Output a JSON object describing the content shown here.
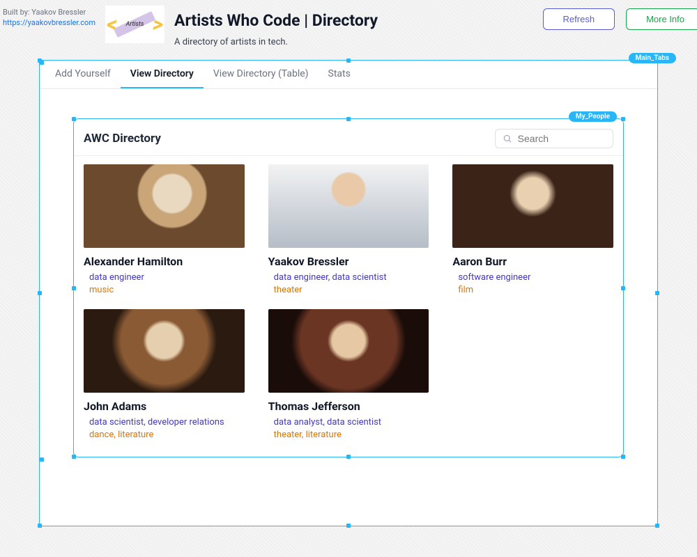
{
  "builtby_label": "Built by: Yaakov Bressler",
  "builtby_link_text": "https://yaakovbressler.com",
  "logo_text": "Artists",
  "page_title": "Artists Who Code | Directory",
  "page_subtitle": "A directory of artists in tech.",
  "buttons": {
    "refresh": "Refresh",
    "more_info": "More Info"
  },
  "badges": {
    "main_tabs": "Main_Tabs",
    "my_people": "My_People"
  },
  "tabs": [
    "Add Yourself",
    "View Directory",
    "View Directory (Table)",
    "Stats"
  ],
  "active_tab_index": 1,
  "panel_title": "AWC Directory",
  "search_placeholder": "Search",
  "people": [
    {
      "name": "Alexander Hamilton",
      "roles": "data engineer",
      "arts": "music"
    },
    {
      "name": "Yaakov Bressler",
      "roles": "data engineer, data scientist",
      "arts": "theater"
    },
    {
      "name": "Aaron Burr",
      "roles": "software engineer",
      "arts": "film"
    },
    {
      "name": "John Adams",
      "roles": "data scientist, developer relations",
      "arts": "dance, literature"
    },
    {
      "name": "Thomas Jefferson",
      "roles": "data analyst, data scientist",
      "arts": "theater, literature"
    }
  ]
}
